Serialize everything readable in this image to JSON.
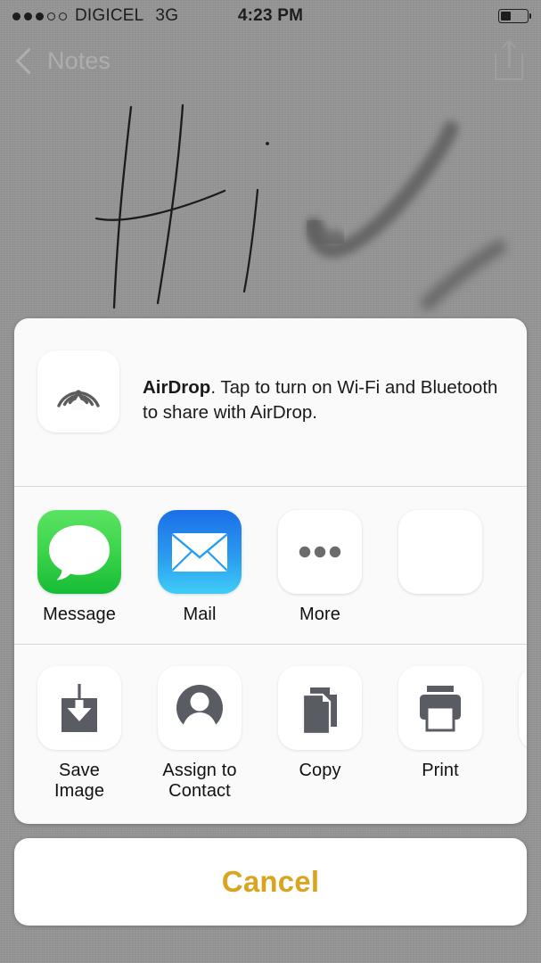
{
  "status_bar": {
    "signal_dots_filled": 3,
    "signal_dots_total": 5,
    "carrier": "DIGICEL",
    "network": "3G",
    "time": "4:23 PM",
    "battery_percent": 40
  },
  "nav_bar": {
    "back_label": "Notes",
    "back_icon": "chevron-left-icon",
    "share_icon": "share-box-arrow-up-icon"
  },
  "share_sheet": {
    "airdrop": {
      "icon": "airdrop-icon",
      "title": "AirDrop",
      "message": ". Tap to turn on Wi-Fi and Bluetooth to share with AirDrop."
    },
    "apps": [
      {
        "label": "Message",
        "icon": "messages-app-icon",
        "color_top": "#5BE363",
        "color_bottom": "#17BC36"
      },
      {
        "label": "Mail",
        "icon": "mail-app-icon",
        "color_top": "#1C6EE8",
        "color_bottom": "#3FCCF7"
      },
      {
        "label": "More",
        "icon": "more-ellipsis-icon",
        "color_top": "#FFFFFF",
        "color_bottom": "#FFFFFF"
      }
    ],
    "actions": [
      {
        "label": "Save Image",
        "icon": "save-image-icon"
      },
      {
        "label": "Assign to Contact",
        "icon": "person-circle-icon"
      },
      {
        "label": "Copy",
        "icon": "copy-documents-icon"
      },
      {
        "label": "Print",
        "icon": "printer-icon"
      }
    ],
    "cancel_label": "Cancel",
    "cancel_color": "#D9A520"
  },
  "canvas": {
    "background_color": "#959595",
    "content_description": "Handwritten sketch reading Hi"
  }
}
